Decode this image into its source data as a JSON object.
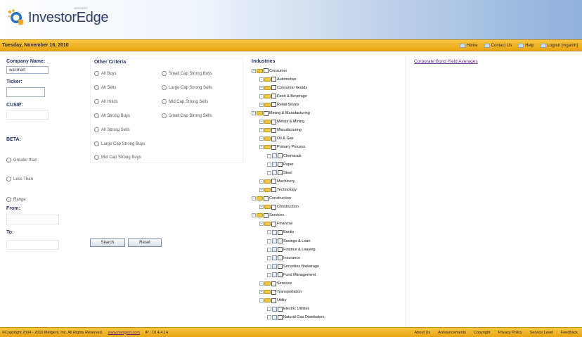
{
  "header": {
    "brand": "InvestorEdge",
    "brand_small": "MERGENT"
  },
  "topbar": {
    "date": "Tuesday, November 16, 2010",
    "nav": [
      {
        "label": "Home",
        "icon": "home-icon"
      },
      {
        "label": "Contact Us",
        "icon": "contact-icon"
      },
      {
        "label": "Help",
        "icon": "help-icon"
      },
      {
        "label": "Logout [mgamh]",
        "icon": "logout-icon"
      }
    ]
  },
  "left": {
    "company_label": "Company Name:",
    "company_value": "wal-mart",
    "ticker_label": "Ticker:",
    "ticker_value": "",
    "cusip_label": "CUSIP:",
    "cusip_value": "",
    "beta_label": "BETA:",
    "beta_options": [
      "Greater than",
      "Less Than",
      "Range"
    ],
    "from_label": "From:",
    "to_label": "To:"
  },
  "criteria": {
    "title": "Other Criteria",
    "col1": [
      "All Buys",
      "All Sells",
      "All Holds",
      "All Strong Buys",
      "All Strong Sells",
      "Large Cap Strong Buys",
      "Mid Cap Strong Buys"
    ],
    "col2": [
      "Small Cap Strong Buys",
      "Large Cap Strong Sells",
      "Mid Cap Strong Sells",
      "Small Cap Strong Sells"
    ]
  },
  "buttons": {
    "search": "Search",
    "reset": "Reset"
  },
  "industries": {
    "title": "Industries",
    "nodes": [
      {
        "label": "Consumer",
        "level": 0,
        "type": "folder"
      },
      {
        "label": "Automotive",
        "level": 1,
        "type": "folder"
      },
      {
        "label": "Consumer Goods",
        "level": 1,
        "type": "folder"
      },
      {
        "label": "Food & Beverage",
        "level": 1,
        "type": "folder"
      },
      {
        "label": "Retail Stores",
        "level": 1,
        "type": "folder"
      },
      {
        "label": "Mining & Manufacturing",
        "level": 0,
        "type": "folder"
      },
      {
        "label": "Metals & Mining",
        "level": 1,
        "type": "folder"
      },
      {
        "label": "Manufacturing",
        "level": 1,
        "type": "folder"
      },
      {
        "label": "Oil & Gas",
        "level": 1,
        "type": "folder"
      },
      {
        "label": "Primary Process",
        "level": 1,
        "type": "folder"
      },
      {
        "label": "Chemicals",
        "level": 2,
        "type": "leaf"
      },
      {
        "label": "Paper",
        "level": 2,
        "type": "leaf"
      },
      {
        "label": "Steel",
        "level": 2,
        "type": "leaf"
      },
      {
        "label": "Machinery",
        "level": 1,
        "type": "folder"
      },
      {
        "label": "Technology",
        "level": 1,
        "type": "folder"
      },
      {
        "label": "Construction",
        "level": 0,
        "type": "folder"
      },
      {
        "label": "Construction",
        "level": 1,
        "type": "folder"
      },
      {
        "label": "Services",
        "level": 0,
        "type": "folder"
      },
      {
        "label": "Financial",
        "level": 1,
        "type": "folder"
      },
      {
        "label": "Banks",
        "level": 2,
        "type": "leaf"
      },
      {
        "label": "Savings & Loan",
        "level": 2,
        "type": "leaf"
      },
      {
        "label": "Finance & Leasing",
        "level": 2,
        "type": "leaf"
      },
      {
        "label": "Insurance",
        "level": 2,
        "type": "leaf"
      },
      {
        "label": "Securities Brokerage",
        "level": 2,
        "type": "leaf"
      },
      {
        "label": "Fund Management",
        "level": 2,
        "type": "leaf"
      },
      {
        "label": "Services",
        "level": 1,
        "type": "folder"
      },
      {
        "label": "Transportation",
        "level": 1,
        "type": "folder"
      },
      {
        "label": "Utility",
        "level": 1,
        "type": "folder"
      },
      {
        "label": "Electric Utilities",
        "level": 2,
        "type": "leaf"
      },
      {
        "label": "Natural Gas Distributors",
        "level": 2,
        "type": "leaf"
      }
    ]
  },
  "right": {
    "bond_link": "Corporate Bond Yield Averages"
  },
  "footer": {
    "copyright": "©Copyright 2004 - 2010 Mergent, Inc. All Rights Reserved.",
    "site": "www.mergent.com",
    "ip": "IP : 10.4.4.14",
    "links": [
      "About Us",
      "Announcements",
      "Copyright",
      "Privacy Policy",
      "Service Level",
      "Feedback"
    ]
  }
}
